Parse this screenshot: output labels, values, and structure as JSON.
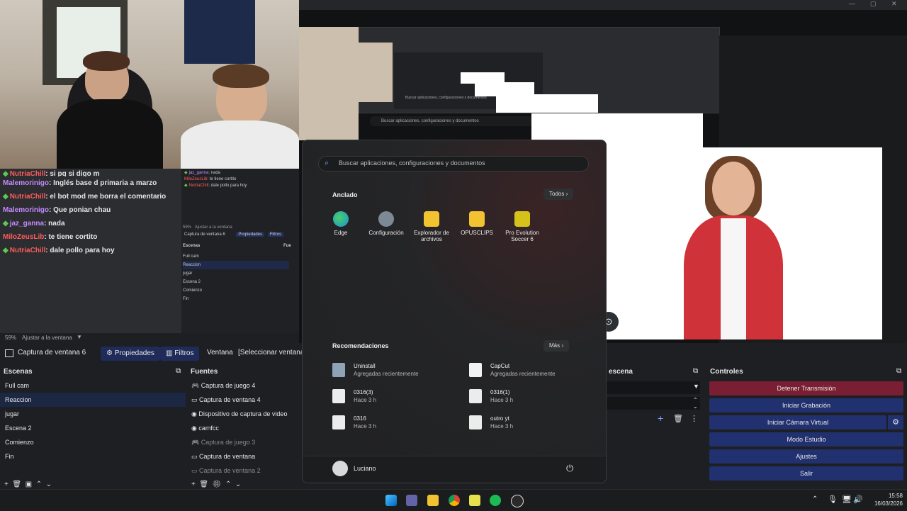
{
  "chat": {
    "messages": [
      {
        "user": "NutriaChill",
        "text": ": si pq si digo m",
        "style": "green-red"
      },
      {
        "user": "Malemorinigo",
        "text": ": Inglés base d primaria a marzo",
        "style": "purple"
      },
      {
        "user": "NutriaChill",
        "text": ": el bot mod me borra el comentario",
        "style": "green-red"
      },
      {
        "user": "Malemorinigo",
        "text": ": Que ponian chau",
        "style": "purple"
      },
      {
        "user": "jaz_ganna",
        "text": ": nada",
        "style": "green-purple"
      },
      {
        "user": "MiloZeusLib",
        "text": ": te tiene cortito",
        "style": "red"
      },
      {
        "user": "NutriaChill",
        "text": ": dale pollo para hoy",
        "style": "green-red"
      }
    ]
  },
  "mini_chat": {
    "lines": [
      {
        "user": "jaz_ganna",
        "text": ": nada"
      },
      {
        "user": "MiloZeusLib",
        "text": ": te tiene cortito"
      },
      {
        "user": "NutriaChill",
        "text": ": dale pollo para hoy"
      }
    ]
  },
  "zoom": {
    "level": "59%",
    "fit_label": "Ajustar a la ventana"
  },
  "toolbar": {
    "source_name": "Captura de ventana 6",
    "properties_label": "Propiedades",
    "filters_label": "Filtros",
    "window_label": "Ventana",
    "window_value": "[Seleccionar ventana p"
  },
  "scenes": {
    "title": "Escenas",
    "items": [
      "Full cam",
      "Reaccion",
      "jugar",
      "Escena 2",
      "Comienzo",
      "Fin"
    ],
    "selected_index": 1
  },
  "sources": {
    "title": "Fuentes",
    "items": [
      {
        "label": "Captura de juego 4",
        "icon": "gamepad-icon",
        "dim": false
      },
      {
        "label": "Captura de ventana 4",
        "icon": "window-icon",
        "dim": false
      },
      {
        "label": "Dispositivo de captura de video",
        "icon": "camera-icon",
        "dim": false
      },
      {
        "label": "camfcc",
        "icon": "camera-icon",
        "dim": false
      },
      {
        "label": "Captura de juego 3",
        "icon": "gamepad-icon",
        "dim": true
      },
      {
        "label": "Captura de ventana",
        "icon": "window-icon",
        "dim": false
      },
      {
        "label": "Captura de ventana 2",
        "icon": "window-icon",
        "dim": true
      }
    ]
  },
  "mini_obs": {
    "zoom": "59%",
    "fit": "Ajustar a la ventana",
    "source": "Captura de ventana 6",
    "props": "Propiedades",
    "filters": "Filtros",
    "scenes_title": "Escenas",
    "sources_title": "Fue",
    "scenes": [
      "Full cam",
      "Reaccion",
      "jugar",
      "Escena 2",
      "Comienzo",
      "Fin"
    ]
  },
  "nested_search": [
    "Buscar aplicaciones, configuraciones y documentos",
    "Buscar aplicaciones, configuraciones y documentos"
  ],
  "start_menu": {
    "search_placeholder": "Buscar aplicaciones, configuraciones y documentos",
    "pinned_title": "Anclado",
    "all_label": "Todos",
    "pinned_apps": [
      {
        "label": "Edge",
        "icon": "edge-icon",
        "color": "#1e90d6"
      },
      {
        "label": "Configuración",
        "icon": "gear-icon",
        "color": "#7d8a96"
      },
      {
        "label": "Explorador de archivos",
        "icon": "folder-icon",
        "color": "#f2c230"
      },
      {
        "label": "OPUSCLIPS",
        "icon": "folder-icon",
        "color": "#f2c230"
      },
      {
        "label": "Pro Evolution Soccer 6",
        "icon": "pes-icon",
        "color": "#d4c21a"
      }
    ],
    "recommended_title": "Recomendaciones",
    "more_label": "Más",
    "recommended": [
      {
        "title": "Uninstall",
        "sub": "Agregadas recientemente",
        "icon": "uninstall-icon"
      },
      {
        "title": "CapCut",
        "sub": "Agregadas recientemente",
        "icon": "capcut-icon"
      },
      {
        "title": "0316(3)",
        "sub": "Hace 3 h",
        "icon": "video-file-icon"
      },
      {
        "title": "0316(1)",
        "sub": "Hace 3 h",
        "icon": "video-file-icon"
      },
      {
        "title": "0316",
        "sub": "Hace 3 h",
        "icon": "video-file-icon"
      },
      {
        "title": "outro yt",
        "sub": "Hace 3 h",
        "icon": "video-file-icon"
      }
    ],
    "user_name": "Luciano"
  },
  "transitions": {
    "title": "escena"
  },
  "controls": {
    "title": "Controles",
    "buttons": [
      {
        "label": "Detener Transmisión",
        "color": "#7a1e33"
      },
      {
        "label": "Iniciar Grabación",
        "color": "#21306e"
      },
      {
        "label": "Iniciar Cámara Virtual",
        "color": "#21306e"
      },
      {
        "label": "Modo Estudio",
        "color": "#21306e"
      },
      {
        "label": "Ajustes",
        "color": "#21306e"
      },
      {
        "label": "Salir",
        "color": "#21306e"
      }
    ]
  },
  "taskbar": {
    "time": "15:58",
    "date": "16/03/2026",
    "icons": [
      "windows-icon",
      "teams-icon",
      "explorer-icon",
      "chrome-icon",
      "notes-icon",
      "spotify-icon",
      "obs-icon"
    ]
  }
}
